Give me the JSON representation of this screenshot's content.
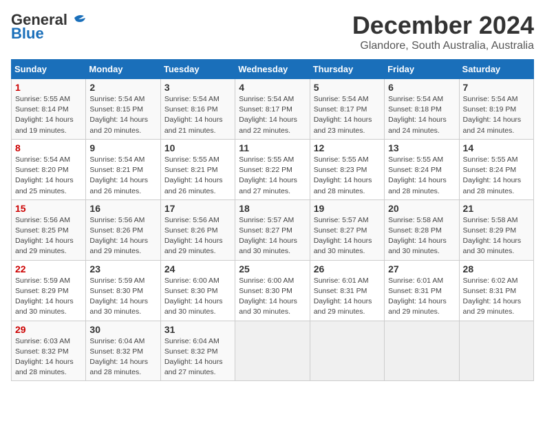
{
  "header": {
    "logo_line1": "General",
    "logo_line2": "Blue",
    "title": "December 2024",
    "subtitle": "Glandore, South Australia, Australia"
  },
  "weekdays": [
    "Sunday",
    "Monday",
    "Tuesday",
    "Wednesday",
    "Thursday",
    "Friday",
    "Saturday"
  ],
  "weeks": [
    [
      {
        "day": "1",
        "sr": "5:55 AM",
        "ss": "8:14 PM",
        "dl": "14 hours and 19 minutes."
      },
      {
        "day": "2",
        "sr": "5:54 AM",
        "ss": "8:15 PM",
        "dl": "14 hours and 20 minutes."
      },
      {
        "day": "3",
        "sr": "5:54 AM",
        "ss": "8:16 PM",
        "dl": "14 hours and 21 minutes."
      },
      {
        "day": "4",
        "sr": "5:54 AM",
        "ss": "8:17 PM",
        "dl": "14 hours and 22 minutes."
      },
      {
        "day": "5",
        "sr": "5:54 AM",
        "ss": "8:17 PM",
        "dl": "14 hours and 23 minutes."
      },
      {
        "day": "6",
        "sr": "5:54 AM",
        "ss": "8:18 PM",
        "dl": "14 hours and 24 minutes."
      },
      {
        "day": "7",
        "sr": "5:54 AM",
        "ss": "8:19 PM",
        "dl": "14 hours and 24 minutes."
      }
    ],
    [
      {
        "day": "8",
        "sr": "5:54 AM",
        "ss": "8:20 PM",
        "dl": "14 hours and 25 minutes."
      },
      {
        "day": "9",
        "sr": "5:54 AM",
        "ss": "8:21 PM",
        "dl": "14 hours and 26 minutes."
      },
      {
        "day": "10",
        "sr": "5:55 AM",
        "ss": "8:21 PM",
        "dl": "14 hours and 26 minutes."
      },
      {
        "day": "11",
        "sr": "5:55 AM",
        "ss": "8:22 PM",
        "dl": "14 hours and 27 minutes."
      },
      {
        "day": "12",
        "sr": "5:55 AM",
        "ss": "8:23 PM",
        "dl": "14 hours and 28 minutes."
      },
      {
        "day": "13",
        "sr": "5:55 AM",
        "ss": "8:24 PM",
        "dl": "14 hours and 28 minutes."
      },
      {
        "day": "14",
        "sr": "5:55 AM",
        "ss": "8:24 PM",
        "dl": "14 hours and 28 minutes."
      }
    ],
    [
      {
        "day": "15",
        "sr": "5:56 AM",
        "ss": "8:25 PM",
        "dl": "14 hours and 29 minutes."
      },
      {
        "day": "16",
        "sr": "5:56 AM",
        "ss": "8:26 PM",
        "dl": "14 hours and 29 minutes."
      },
      {
        "day": "17",
        "sr": "5:56 AM",
        "ss": "8:26 PM",
        "dl": "14 hours and 29 minutes."
      },
      {
        "day": "18",
        "sr": "5:57 AM",
        "ss": "8:27 PM",
        "dl": "14 hours and 30 minutes."
      },
      {
        "day": "19",
        "sr": "5:57 AM",
        "ss": "8:27 PM",
        "dl": "14 hours and 30 minutes."
      },
      {
        "day": "20",
        "sr": "5:58 AM",
        "ss": "8:28 PM",
        "dl": "14 hours and 30 minutes."
      },
      {
        "day": "21",
        "sr": "5:58 AM",
        "ss": "8:29 PM",
        "dl": "14 hours and 30 minutes."
      }
    ],
    [
      {
        "day": "22",
        "sr": "5:59 AM",
        "ss": "8:29 PM",
        "dl": "14 hours and 30 minutes."
      },
      {
        "day": "23",
        "sr": "5:59 AM",
        "ss": "8:30 PM",
        "dl": "14 hours and 30 minutes."
      },
      {
        "day": "24",
        "sr": "6:00 AM",
        "ss": "8:30 PM",
        "dl": "14 hours and 30 minutes."
      },
      {
        "day": "25",
        "sr": "6:00 AM",
        "ss": "8:30 PM",
        "dl": "14 hours and 30 minutes."
      },
      {
        "day": "26",
        "sr": "6:01 AM",
        "ss": "8:31 PM",
        "dl": "14 hours and 29 minutes."
      },
      {
        "day": "27",
        "sr": "6:01 AM",
        "ss": "8:31 PM",
        "dl": "14 hours and 29 minutes."
      },
      {
        "day": "28",
        "sr": "6:02 AM",
        "ss": "8:31 PM",
        "dl": "14 hours and 29 minutes."
      }
    ],
    [
      {
        "day": "29",
        "sr": "6:03 AM",
        "ss": "8:32 PM",
        "dl": "14 hours and 28 minutes."
      },
      {
        "day": "30",
        "sr": "6:04 AM",
        "ss": "8:32 PM",
        "dl": "14 hours and 28 minutes."
      },
      {
        "day": "31",
        "sr": "6:04 AM",
        "ss": "8:32 PM",
        "dl": "14 hours and 27 minutes."
      },
      null,
      null,
      null,
      null
    ]
  ]
}
